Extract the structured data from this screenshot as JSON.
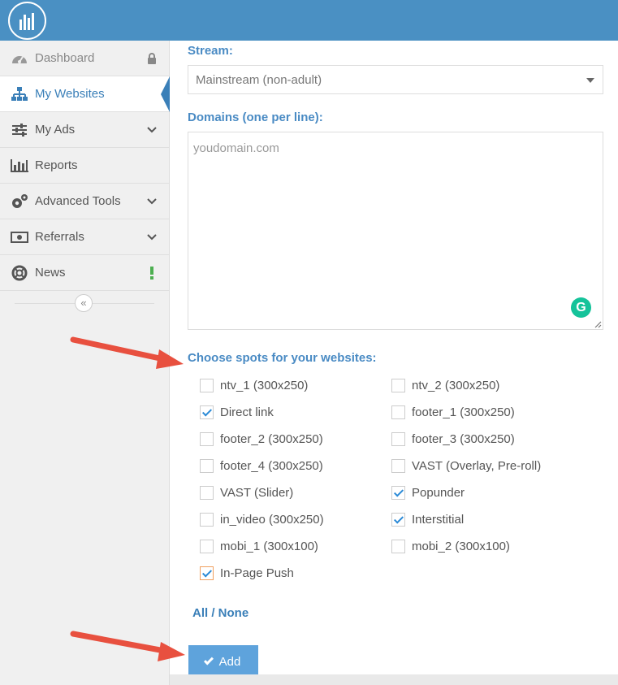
{
  "sidebar": {
    "items": [
      {
        "label": "Dashboard",
        "icon": "speedometer-icon",
        "trail": "lock-icon"
      },
      {
        "label": "My Websites",
        "icon": "sitemap-icon",
        "active": true
      },
      {
        "label": "My Ads",
        "icon": "sliders-icon",
        "trail": "chevron-down-icon"
      },
      {
        "label": "Reports",
        "icon": "bar-chart-icon"
      },
      {
        "label": "Advanced Tools",
        "icon": "gears-icon",
        "trail": "chevron-down-icon"
      },
      {
        "label": "Referrals",
        "icon": "money-icon",
        "trail": "chevron-down-icon"
      },
      {
        "label": "News",
        "icon": "life-ring-icon",
        "trail": "exclamation-icon"
      }
    ],
    "collapse_glyph": "«"
  },
  "form": {
    "stream_label": "Stream:",
    "stream_value": "Mainstream (non-adult)",
    "domains_label": "Domains (one per line):",
    "domains_placeholder": "youdomain.com",
    "spots_label": "Choose spots for your websites:",
    "spots": [
      {
        "label": "ntv_1 (300x250)",
        "checked": false
      },
      {
        "label": "ntv_2 (300x250)",
        "checked": false
      },
      {
        "label": "Direct link",
        "checked": true
      },
      {
        "label": "footer_1 (300x250)",
        "checked": false
      },
      {
        "label": "footer_2 (300x250)",
        "checked": false
      },
      {
        "label": "footer_3 (300x250)",
        "checked": false
      },
      {
        "label": "footer_4 (300x250)",
        "checked": false
      },
      {
        "label": "VAST (Overlay, Pre-roll)",
        "checked": false
      },
      {
        "label": "VAST (Slider)",
        "checked": false
      },
      {
        "label": "Popunder",
        "checked": true
      },
      {
        "label": "in_video (300x250)",
        "checked": false
      },
      {
        "label": "Interstitial",
        "checked": true
      },
      {
        "label": "mobi_1 (300x100)",
        "checked": false
      },
      {
        "label": "mobi_2 (300x100)",
        "checked": false
      },
      {
        "label": "In-Page Push",
        "checked": true
      }
    ],
    "all_none_label": "All / None",
    "add_label": "Add",
    "grammarly_glyph": "G"
  },
  "colors": {
    "topbar": "#4a90c3",
    "accent": "#3a7fb8",
    "arrow": "#e8503f",
    "add_button": "#5ea3dc"
  }
}
